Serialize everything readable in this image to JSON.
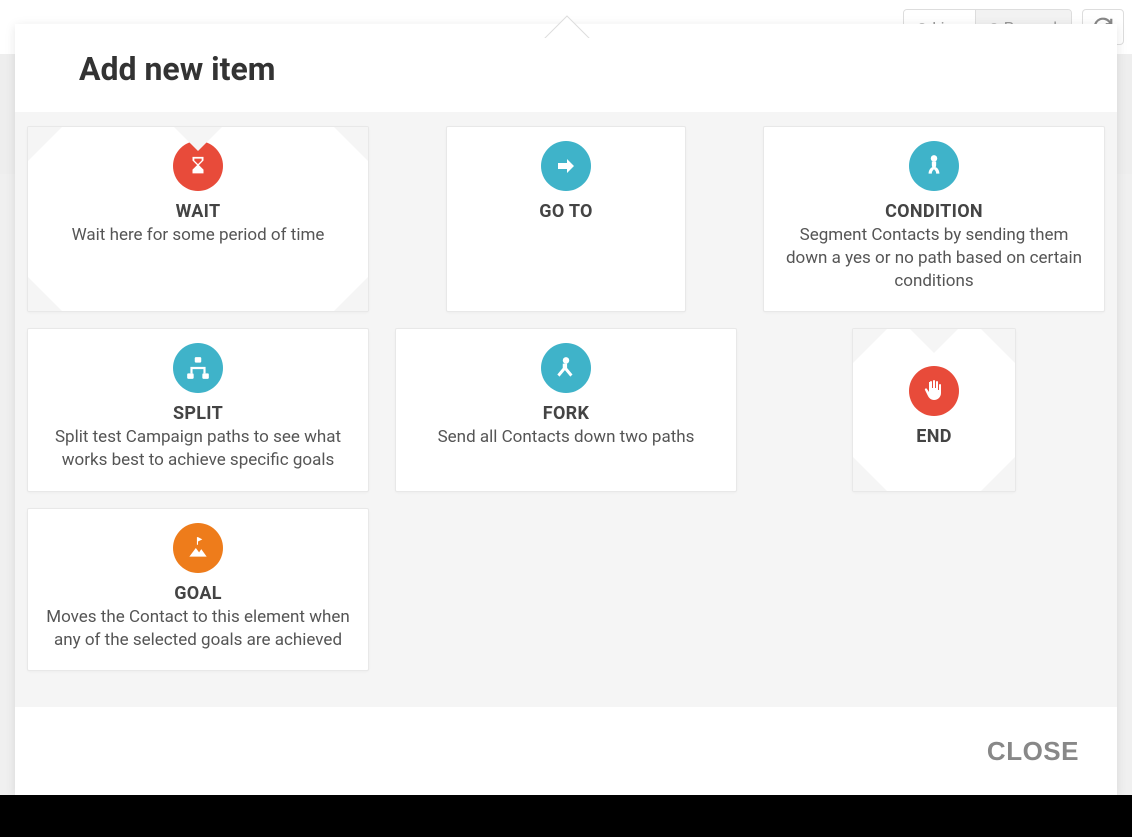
{
  "toolbar": {
    "live_label": "Live",
    "paused_label": "Paused"
  },
  "modal": {
    "title": "Add new item",
    "close_label": "CLOSE",
    "cards": {
      "wait": {
        "title": "WAIT",
        "desc": "Wait here for some period of time"
      },
      "goto": {
        "title": "GO TO",
        "desc": ""
      },
      "condition": {
        "title": "CONDITION",
        "desc": "Segment Contacts by sending them down a yes or no path based on certain conditions"
      },
      "split": {
        "title": "SPLIT",
        "desc": "Split test Campaign paths to see what works best to achieve specific goals"
      },
      "fork": {
        "title": "FORK",
        "desc": "Send all Contacts down two paths"
      },
      "end": {
        "title": "END",
        "desc": ""
      },
      "goal": {
        "title": "GOAL",
        "desc": "Moves the Contact to this element when any of the selected goals are achieved"
      }
    }
  }
}
